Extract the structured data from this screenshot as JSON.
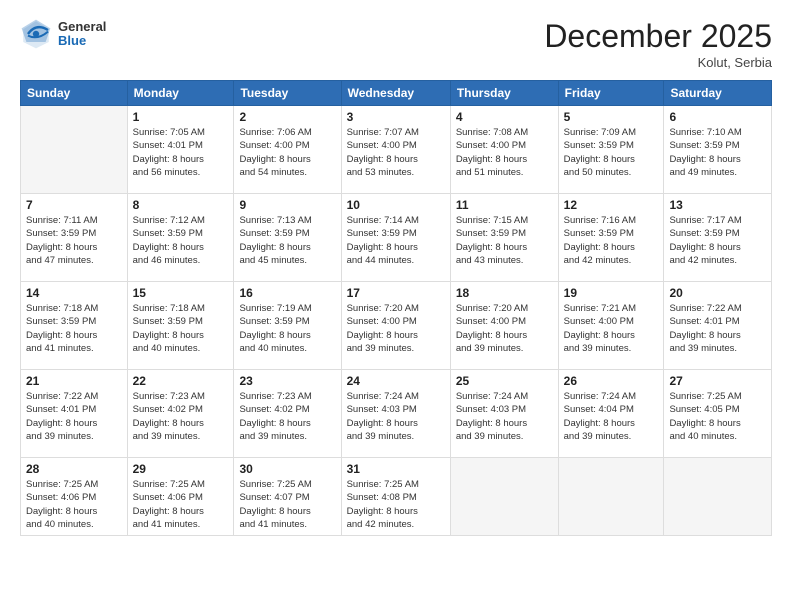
{
  "header": {
    "logo_general": "General",
    "logo_blue": "Blue",
    "title": "December 2025",
    "location": "Kolut, Serbia"
  },
  "weekdays": [
    "Sunday",
    "Monday",
    "Tuesday",
    "Wednesday",
    "Thursday",
    "Friday",
    "Saturday"
  ],
  "weeks": [
    [
      {
        "day": "",
        "info": ""
      },
      {
        "day": "1",
        "info": "Sunrise: 7:05 AM\nSunset: 4:01 PM\nDaylight: 8 hours\nand 56 minutes."
      },
      {
        "day": "2",
        "info": "Sunrise: 7:06 AM\nSunset: 4:00 PM\nDaylight: 8 hours\nand 54 minutes."
      },
      {
        "day": "3",
        "info": "Sunrise: 7:07 AM\nSunset: 4:00 PM\nDaylight: 8 hours\nand 53 minutes."
      },
      {
        "day": "4",
        "info": "Sunrise: 7:08 AM\nSunset: 4:00 PM\nDaylight: 8 hours\nand 51 minutes."
      },
      {
        "day": "5",
        "info": "Sunrise: 7:09 AM\nSunset: 3:59 PM\nDaylight: 8 hours\nand 50 minutes."
      },
      {
        "day": "6",
        "info": "Sunrise: 7:10 AM\nSunset: 3:59 PM\nDaylight: 8 hours\nand 49 minutes."
      }
    ],
    [
      {
        "day": "7",
        "info": "Sunrise: 7:11 AM\nSunset: 3:59 PM\nDaylight: 8 hours\nand 47 minutes."
      },
      {
        "day": "8",
        "info": "Sunrise: 7:12 AM\nSunset: 3:59 PM\nDaylight: 8 hours\nand 46 minutes."
      },
      {
        "day": "9",
        "info": "Sunrise: 7:13 AM\nSunset: 3:59 PM\nDaylight: 8 hours\nand 45 minutes."
      },
      {
        "day": "10",
        "info": "Sunrise: 7:14 AM\nSunset: 3:59 PM\nDaylight: 8 hours\nand 44 minutes."
      },
      {
        "day": "11",
        "info": "Sunrise: 7:15 AM\nSunset: 3:59 PM\nDaylight: 8 hours\nand 43 minutes."
      },
      {
        "day": "12",
        "info": "Sunrise: 7:16 AM\nSunset: 3:59 PM\nDaylight: 8 hours\nand 42 minutes."
      },
      {
        "day": "13",
        "info": "Sunrise: 7:17 AM\nSunset: 3:59 PM\nDaylight: 8 hours\nand 42 minutes."
      }
    ],
    [
      {
        "day": "14",
        "info": "Sunrise: 7:18 AM\nSunset: 3:59 PM\nDaylight: 8 hours\nand 41 minutes."
      },
      {
        "day": "15",
        "info": "Sunrise: 7:18 AM\nSunset: 3:59 PM\nDaylight: 8 hours\nand 40 minutes."
      },
      {
        "day": "16",
        "info": "Sunrise: 7:19 AM\nSunset: 3:59 PM\nDaylight: 8 hours\nand 40 minutes."
      },
      {
        "day": "17",
        "info": "Sunrise: 7:20 AM\nSunset: 4:00 PM\nDaylight: 8 hours\nand 39 minutes."
      },
      {
        "day": "18",
        "info": "Sunrise: 7:20 AM\nSunset: 4:00 PM\nDaylight: 8 hours\nand 39 minutes."
      },
      {
        "day": "19",
        "info": "Sunrise: 7:21 AM\nSunset: 4:00 PM\nDaylight: 8 hours\nand 39 minutes."
      },
      {
        "day": "20",
        "info": "Sunrise: 7:22 AM\nSunset: 4:01 PM\nDaylight: 8 hours\nand 39 minutes."
      }
    ],
    [
      {
        "day": "21",
        "info": "Sunrise: 7:22 AM\nSunset: 4:01 PM\nDaylight: 8 hours\nand 39 minutes."
      },
      {
        "day": "22",
        "info": "Sunrise: 7:23 AM\nSunset: 4:02 PM\nDaylight: 8 hours\nand 39 minutes."
      },
      {
        "day": "23",
        "info": "Sunrise: 7:23 AM\nSunset: 4:02 PM\nDaylight: 8 hours\nand 39 minutes."
      },
      {
        "day": "24",
        "info": "Sunrise: 7:24 AM\nSunset: 4:03 PM\nDaylight: 8 hours\nand 39 minutes."
      },
      {
        "day": "25",
        "info": "Sunrise: 7:24 AM\nSunset: 4:03 PM\nDaylight: 8 hours\nand 39 minutes."
      },
      {
        "day": "26",
        "info": "Sunrise: 7:24 AM\nSunset: 4:04 PM\nDaylight: 8 hours\nand 39 minutes."
      },
      {
        "day": "27",
        "info": "Sunrise: 7:25 AM\nSunset: 4:05 PM\nDaylight: 8 hours\nand 40 minutes."
      }
    ],
    [
      {
        "day": "28",
        "info": "Sunrise: 7:25 AM\nSunset: 4:06 PM\nDaylight: 8 hours\nand 40 minutes."
      },
      {
        "day": "29",
        "info": "Sunrise: 7:25 AM\nSunset: 4:06 PM\nDaylight: 8 hours\nand 41 minutes."
      },
      {
        "day": "30",
        "info": "Sunrise: 7:25 AM\nSunset: 4:07 PM\nDaylight: 8 hours\nand 41 minutes."
      },
      {
        "day": "31",
        "info": "Sunrise: 7:25 AM\nSunset: 4:08 PM\nDaylight: 8 hours\nand 42 minutes."
      },
      {
        "day": "",
        "info": ""
      },
      {
        "day": "",
        "info": ""
      },
      {
        "day": "",
        "info": ""
      }
    ]
  ]
}
